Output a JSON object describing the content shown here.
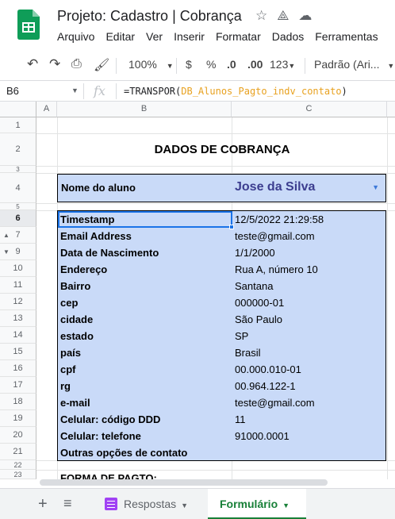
{
  "titlebar": {
    "doc_title": "Projeto: Cadastro | Cobrança",
    "menu": [
      "Arquivo",
      "Editar",
      "Ver",
      "Inserir",
      "Formatar",
      "Dados",
      "Ferramentas"
    ]
  },
  "toolbar": {
    "zoom": "100%",
    "currency": "$",
    "percent": "%",
    "dec_less": ".0",
    "dec_more": ".00",
    "number_format": "123",
    "font": "Padrão (Ari..."
  },
  "formula_bar": {
    "cell_ref": "B6",
    "fx": "fx",
    "formula_prefix": "=TRANSPOR(",
    "formula_ref": "DB_Alunos_Pagto_indv_contato",
    "formula_suffix": ")"
  },
  "columns": [
    "A",
    "B",
    "C"
  ],
  "rows": [
    "1",
    "2",
    "3",
    "4",
    "5",
    "6",
    "7",
    "9",
    "10",
    "11",
    "12",
    "13",
    "14",
    "15",
    "16",
    "17",
    "18",
    "19",
    "20",
    "21",
    "22",
    "23"
  ],
  "sheet": {
    "title": "DADOS DE COBRANÇA",
    "aluno_label": "Nome do aluno",
    "aluno_value": "Jose da Silva",
    "fields": [
      {
        "label": "Timestamp",
        "value": "12/5/2022 21:29:58"
      },
      {
        "label": "Email Address",
        "value": "teste@gmail.com"
      },
      {
        "label": "Data de Nascimento",
        "value": "1/1/2000"
      },
      {
        "label": "Endereço",
        "value": "Rua A, número 10"
      },
      {
        "label": "Bairro",
        "value": "Santana"
      },
      {
        "label": "cep",
        "value": "000000-01"
      },
      {
        "label": "cidade",
        "value": "São Paulo"
      },
      {
        "label": "estado",
        "value": "SP"
      },
      {
        "label": "país",
        "value": "Brasil"
      },
      {
        "label": "cpf",
        "value": "00.000.010-01"
      },
      {
        "label": "rg",
        "value": "00.964.122-1"
      },
      {
        "label": "e-mail",
        "value": "teste@gmail.com"
      },
      {
        "label": "Celular: código DDD",
        "value": "11"
      },
      {
        "label": "Celular: telefone",
        "value": "91000.0001"
      },
      {
        "label": "Outras opções de contato",
        "value": ""
      }
    ],
    "forma_pagto": "FORMA DE PAGTO:"
  },
  "tabs": {
    "add": "+",
    "all": "≡",
    "respostas": "Respostas",
    "formulario": "Formulário"
  },
  "colors": {
    "accent": "#1a73e8",
    "cell_fill": "#c9daf8",
    "active_tab": "#188038",
    "name_value": "#3c3d8f",
    "formula_ref": "#e8a11f"
  }
}
